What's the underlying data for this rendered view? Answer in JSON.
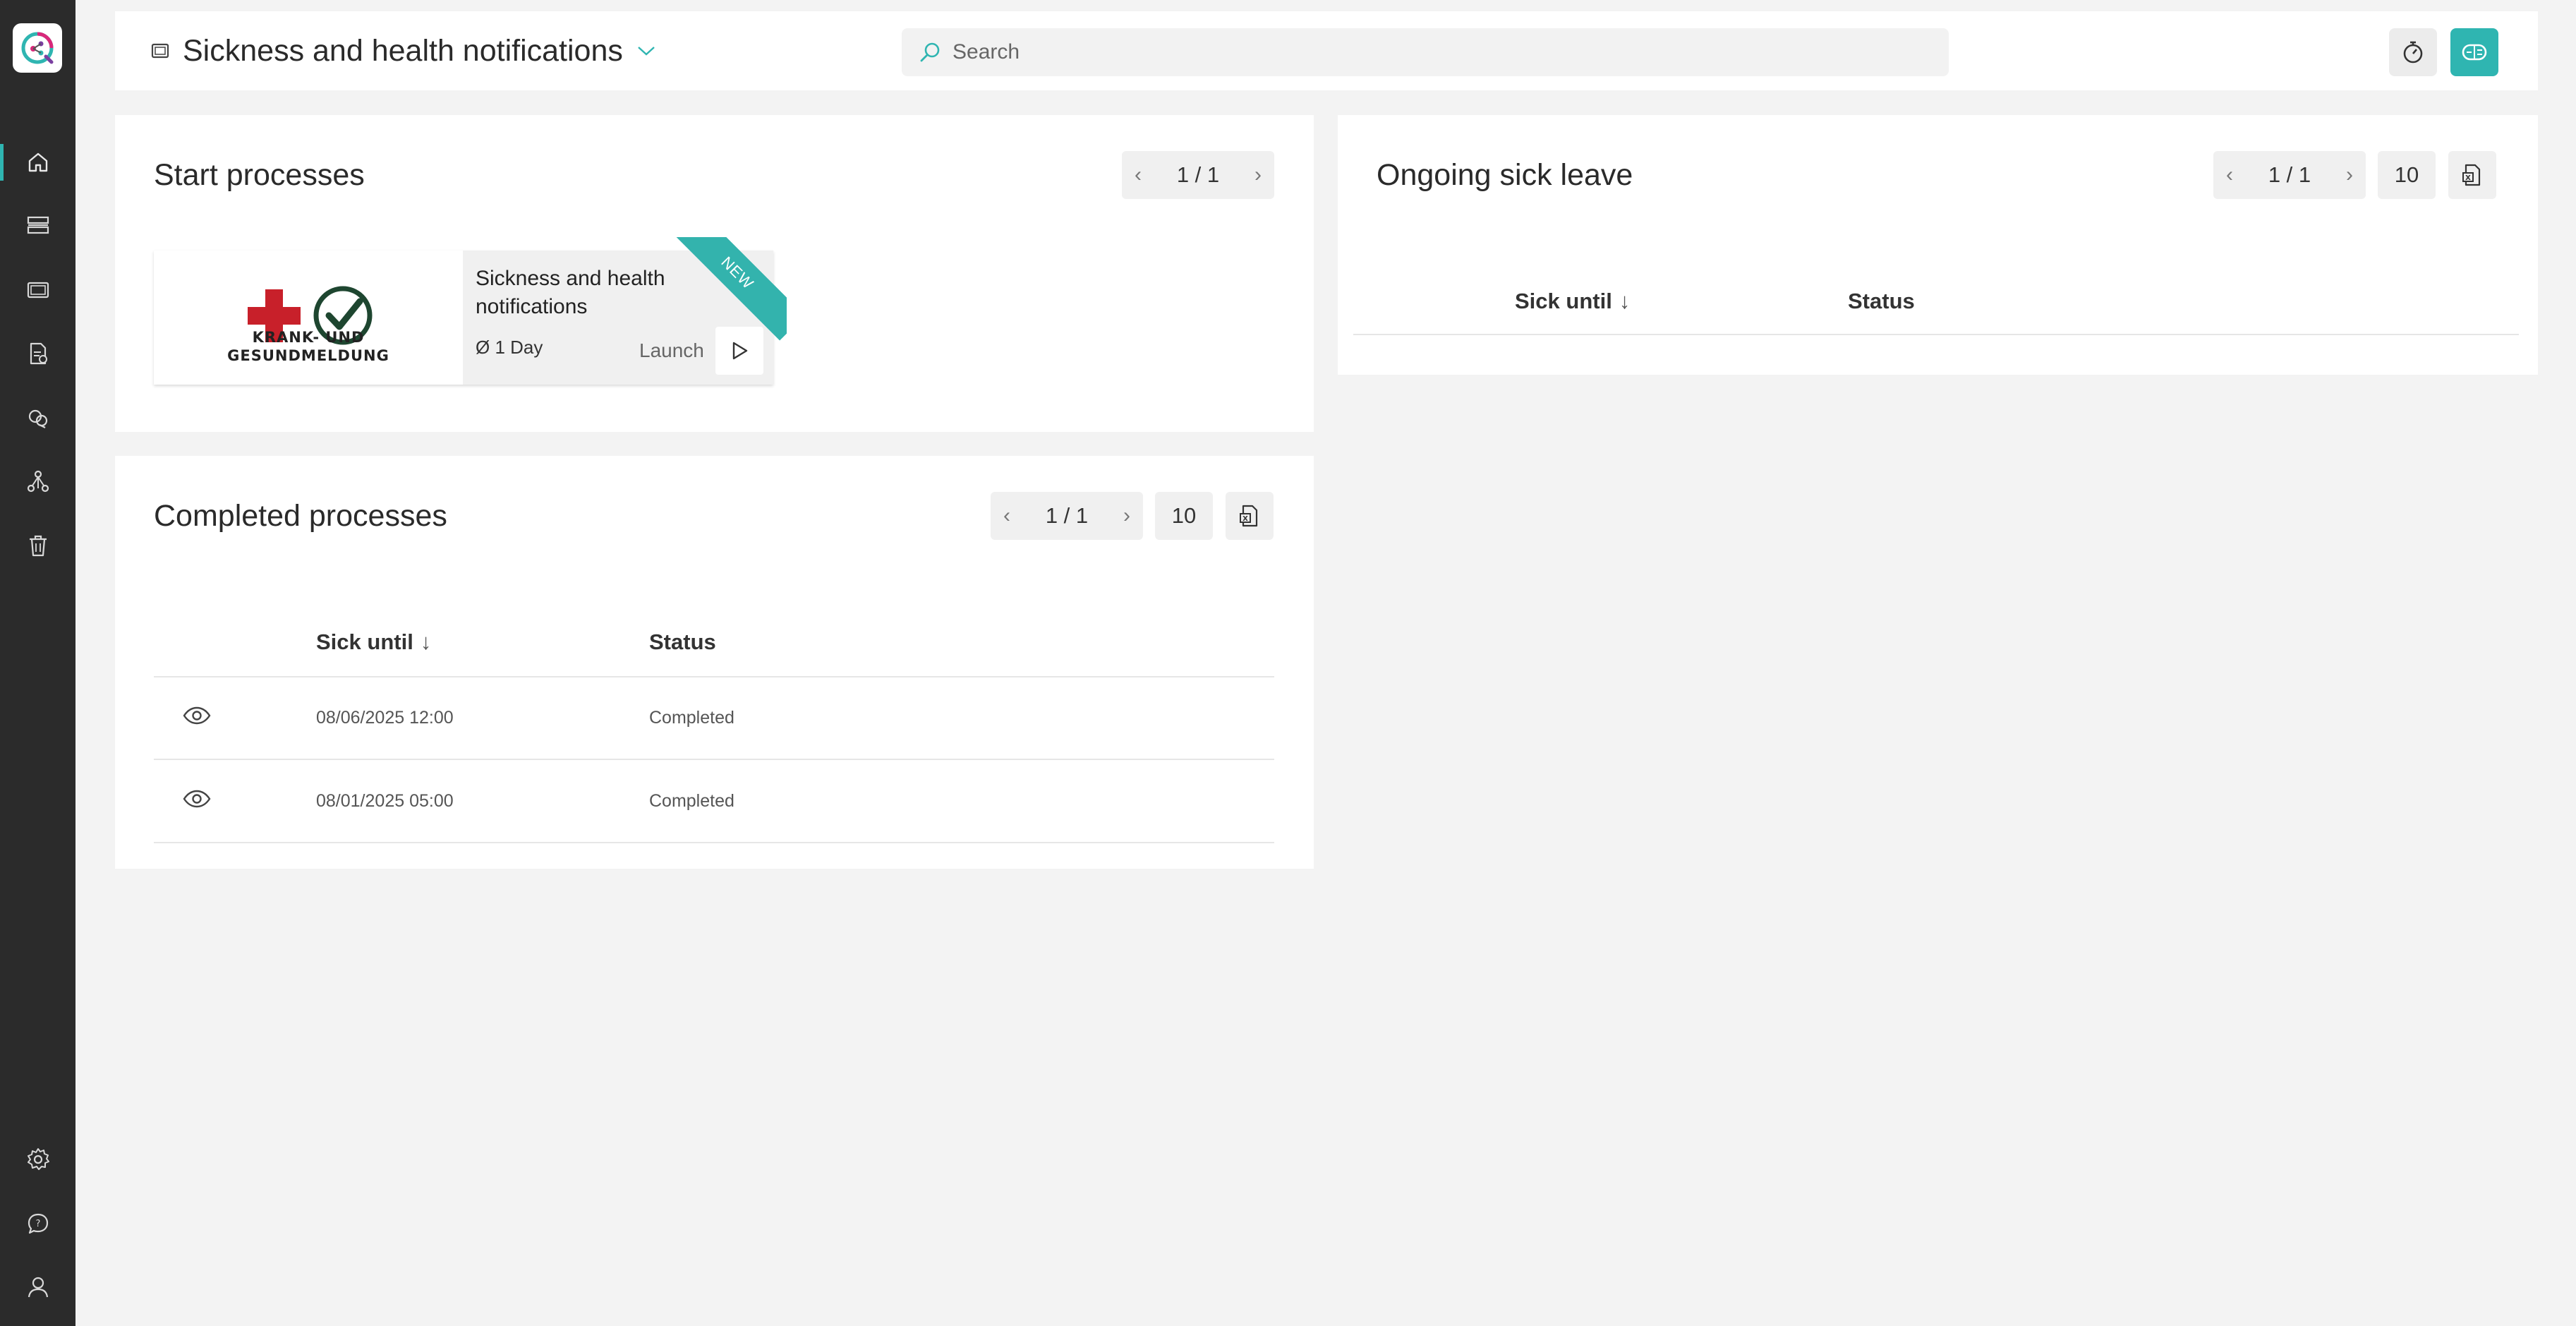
{
  "header": {
    "title": "Sickness and health notifications",
    "search_placeholder": "Search"
  },
  "sidebar": {
    "items": [
      "home",
      "processes",
      "documents",
      "forms",
      "tags",
      "organization",
      "trash"
    ],
    "bottom": [
      "settings",
      "feedback",
      "profile"
    ]
  },
  "start_processes": {
    "title": "Start processes",
    "pager": "1 / 1",
    "card": {
      "logo_line1": "KRANK- UND",
      "logo_line2": "GESUNDMELDUNG",
      "name": "Sickness and health notifications",
      "duration": "Ø 1 Day",
      "launch_label": "Launch",
      "ribbon": "NEW"
    }
  },
  "completed_processes": {
    "title": "Completed processes",
    "pager": "1 / 1",
    "page_size": "10",
    "columns": [
      "Sick until",
      "Status"
    ],
    "rows": [
      {
        "sick_until": "08/06/2025 12:00",
        "status": "Completed"
      },
      {
        "sick_until": "08/01/2025 05:00",
        "status": "Completed"
      }
    ]
  },
  "ongoing_sick_leave": {
    "title": "Ongoing sick leave",
    "pager": "1 / 1",
    "page_size": "10",
    "columns": [
      "Sick until",
      "Status"
    ]
  },
  "colors": {
    "accent": "#2fb5b1",
    "sidebar": "#2b2b2b",
    "background": "#f3f3f3"
  }
}
